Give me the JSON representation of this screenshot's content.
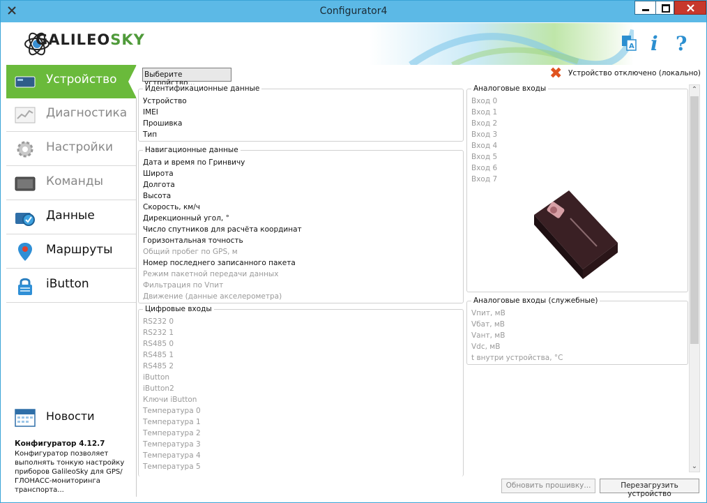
{
  "window": {
    "title": "Configurator4"
  },
  "header": {
    "logo_text": "GALILEO",
    "logo_text_accent": "SKY"
  },
  "sidebar": {
    "items": [
      {
        "label": "Устройство",
        "active": true
      },
      {
        "label": "Диагностика",
        "disabled": true
      },
      {
        "label": "Настройки",
        "disabled": true
      },
      {
        "label": "Команды",
        "disabled": true
      },
      {
        "label": "Данные"
      },
      {
        "label": "Маршруты"
      },
      {
        "label": "iButton"
      }
    ],
    "news_label": "Новости",
    "version_title": "Конфигуратор 4.12.7",
    "version_desc": "Конфигуратор позволяет выполнять тонкую настройку приборов GalileoSky для GPS/ГЛОНАСС-мониторинга транспорта..."
  },
  "toolbar": {
    "select_device_label": "Выберите устройство...",
    "status_text": "Устройство отключено (локально)"
  },
  "identification": {
    "title": "Идентификационные данные",
    "rows": [
      "Устройство",
      "IMEI",
      "Прошивка",
      "Тип"
    ]
  },
  "navigation": {
    "title": "Навигационные данные",
    "rows": [
      {
        "label": "Дата и время по Гринвичу",
        "dim": false
      },
      {
        "label": "Широта",
        "dim": false
      },
      {
        "label": "Долгота",
        "dim": false
      },
      {
        "label": "Высота",
        "dim": false
      },
      {
        "label": "Скорость, км/ч",
        "dim": false
      },
      {
        "label": "Дирекционный угол, °",
        "dim": false
      },
      {
        "label": "Число спутников для расчёта координат",
        "dim": false
      },
      {
        "label": "Горизонтальная точность",
        "dim": false
      },
      {
        "label": "Общий пробег по GPS, м",
        "dim": true
      },
      {
        "label": "Номер последнего записанного пакета",
        "dim": false
      },
      {
        "label": "Режим пакетной передачи данных",
        "dim": true
      },
      {
        "label": "Фильтрация по Vпит",
        "dim": true
      },
      {
        "label": "Движение (данные акселерометра)",
        "dim": true
      }
    ]
  },
  "digital_inputs": {
    "title": "Цифровые входы",
    "rows": [
      "RS232 0",
      "RS232 1",
      "RS485 0",
      "RS485 1",
      "RS485 2",
      "iButton",
      "iButton2",
      "Ключи iButton",
      "Температура 0",
      "Температура 1",
      "Температура 2",
      "Температура 3",
      "Температура 4",
      "Температура 5"
    ]
  },
  "analog_inputs": {
    "title": "Аналоговые входы",
    "rows": [
      "Вход 0",
      "Вход 1",
      "Вход 2",
      "Вход 3",
      "Вход 4",
      "Вход 5",
      "Вход 6",
      "Вход 7"
    ]
  },
  "analog_service": {
    "title": "Аналоговые входы (служебные)",
    "rows": [
      "Vпит, мВ",
      "Vбат, мВ",
      "Vант, мВ",
      "Vdc, мВ",
      "t внутри устройства, °C"
    ]
  },
  "buttons": {
    "update_firmware": "Обновить прошивку...",
    "reboot_device": "Перезагрузить устройство"
  }
}
